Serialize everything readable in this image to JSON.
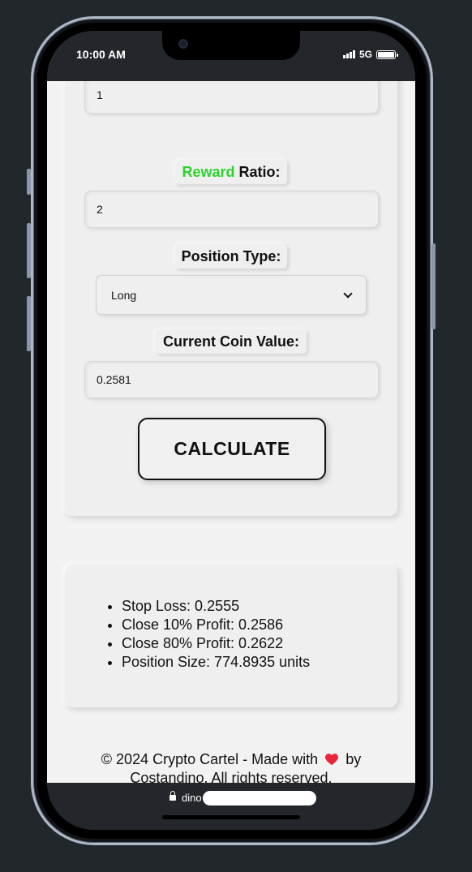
{
  "status_bar": {
    "time": "10:00 AM",
    "network": "5G"
  },
  "form": {
    "risk_value": "1",
    "reward_label_highlight": "Reward",
    "reward_label_rest": " Ratio:",
    "reward_value": "2",
    "position_type_label": "Position Type:",
    "position_type_selected": "Long",
    "coin_value_label": "Current Coin Value:",
    "coin_value": "0.2581",
    "calculate_label": "CALCULATE"
  },
  "results": [
    "Stop Loss: 0.2555",
    "Close 10% Profit: 0.2586",
    "Close 80% Profit: 0.2622",
    "Position Size: 774.8935 units"
  ],
  "footer": {
    "text_before": "© 2024 Crypto Cartel - Made with",
    "text_after": "by Costandino. All rights reserved."
  },
  "url_bar": {
    "text": "dino"
  },
  "colors": {
    "accent_green": "#2ed12e",
    "heart": "#e8283a",
    "page_bg": "#22272c"
  }
}
